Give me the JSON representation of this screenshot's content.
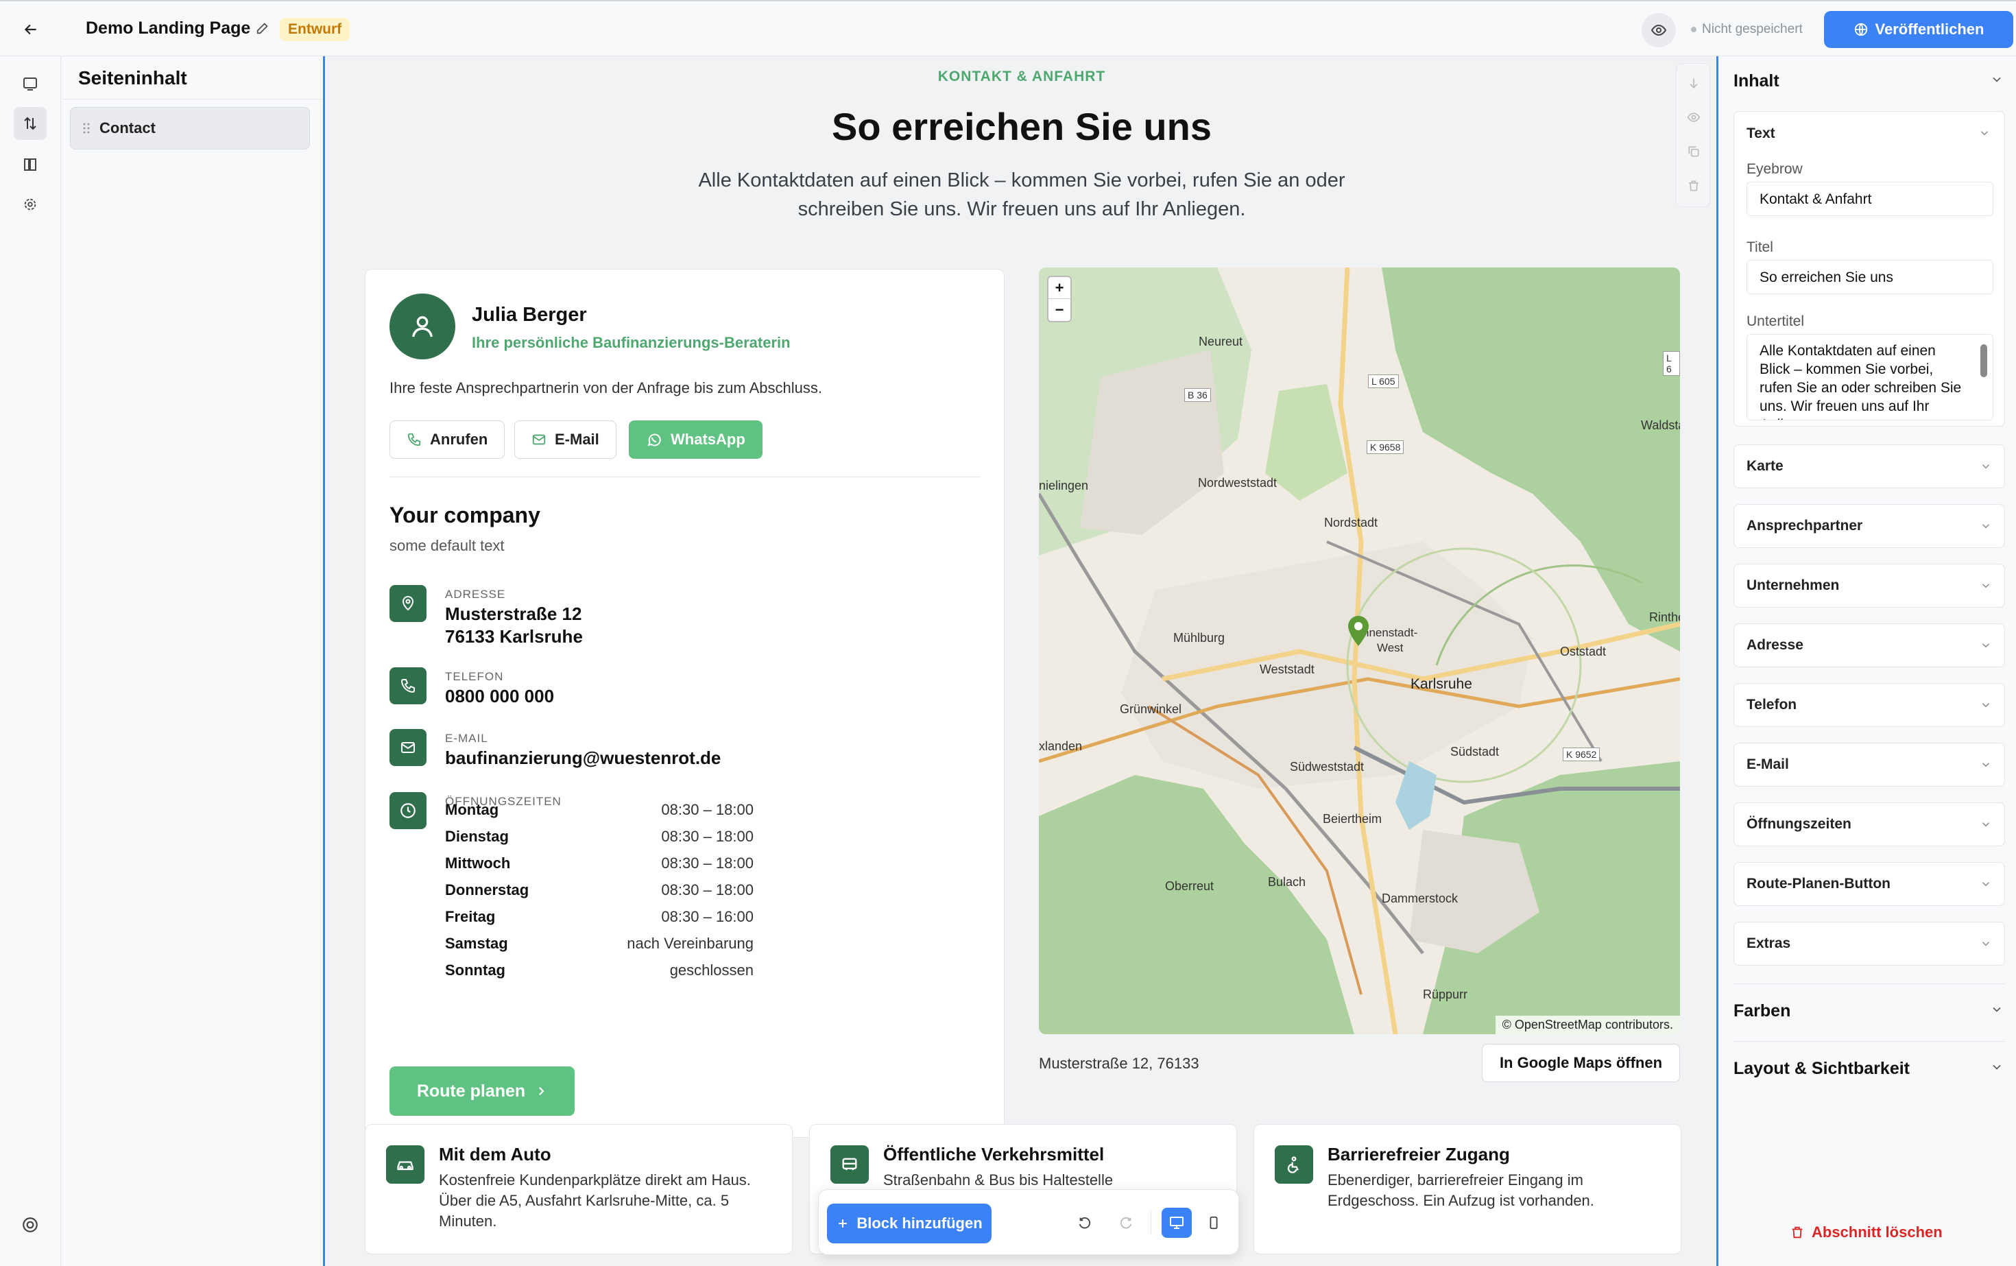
{
  "app": {
    "page_title": "Demo Landing Page",
    "status_badge": "Entwurf",
    "save_status": "Nicht gespeichert",
    "publish_label": "Veröffentlichen"
  },
  "left_panel": {
    "title": "Seiteninhalt",
    "items": [
      {
        "label": "Contact"
      }
    ]
  },
  "section": {
    "eyebrow": "KONTAKT & ANFAHRT",
    "title": "So erreichen Sie uns",
    "subtitle": "Alle Kontaktdaten auf einen Blick – kommen Sie vorbei, rufen Sie an oder schreiben Sie uns. Wir freuen uns auf Ihr Anliegen."
  },
  "contact_person": {
    "name": "Julia Berger",
    "role": "Ihre persönliche Baufinanzierungs-Beraterin",
    "description": "Ihre feste Ansprechpartnerin von der Anfrage bis zum Abschluss.",
    "buttons": {
      "call": "Anrufen",
      "email": "E-Mail",
      "whatsapp": "WhatsApp"
    }
  },
  "company": {
    "name": "Your company",
    "subtitle": "some default text",
    "address_label": "ADRESSE",
    "address_line1": "Musterstraße 12",
    "address_line2": "76133 Karlsruhe",
    "phone_label": "TELEFON",
    "phone": "0800 000 000",
    "email_label": "E-MAIL",
    "email": "baufinanzierung@wuestenrot.de",
    "hours_label": "ÖFFNUNGSZEITEN",
    "hours": [
      {
        "day": "Montag",
        "time": "08:30 – 18:00"
      },
      {
        "day": "Dienstag",
        "time": "08:30 – 18:00"
      },
      {
        "day": "Mittwoch",
        "time": "08:30 – 18:00"
      },
      {
        "day": "Donnerstag",
        "time": "08:30 – 18:00"
      },
      {
        "day": "Freitag",
        "time": "08:30 – 16:00"
      },
      {
        "day": "Samstag",
        "time": "nach Vereinbarung"
      },
      {
        "day": "Sonntag",
        "time": "geschlossen"
      }
    ],
    "route_button": "Route planen"
  },
  "map": {
    "attribution": "© OpenStreetMap contributors.",
    "zoom_in": "+",
    "zoom_out": "−",
    "places": {
      "neureut": "Neureut",
      "nordweststadt": "Nordweststadt",
      "nordstadt": "Nordstadt",
      "muehlburg": "Mühlburg",
      "weststadt": "Weststadt",
      "innenstadt": "nnenstadt-\nWest",
      "karlsruhe": "Karlsruhe",
      "oststadt": "Oststadt",
      "grunwinkel": "Grünwinkel",
      "suedweststadt": "Südweststadt",
      "suedstadt": "Südstadt",
      "beiertheim": "Beiertheim",
      "oberreut": "Oberreut",
      "bulach": "Bulach",
      "dammerstock": "Dammerstock",
      "rueppurr": "Rüppurr",
      "rintheim": "Rinthe",
      "waldstadt": "Waldsta",
      "knielingen": "nielingen",
      "daxlanden": "xlanden",
      "l605": "L 605",
      "k9658": "K 9658",
      "b36": "B 36",
      "k9652": "K 9652",
      "l6": "L 6"
    },
    "address": "Musterstraße 12, 76133",
    "google_button": "In Google Maps öffnen"
  },
  "features": [
    {
      "icon": "car-icon",
      "title": "Mit dem Auto",
      "text": "Kostenfreie Kundenparkplätze direkt am Haus. Über die A5, Ausfahrt Karlsruhe-Mitte, ca. 5 Minuten."
    },
    {
      "icon": "bus-icon",
      "title": "Öffentliche Verkehrsmittel",
      "text": "Straßenbahn & Bus bis Haltestelle"
    },
    {
      "icon": "accessibility-icon",
      "title": "Barrierefreier Zugang",
      "text": "Ebenerdiger, barrierefreier Eingang im Erdgeschoss. Ein Aufzug ist vorhanden."
    }
  ],
  "toolbar": {
    "add_block": "Block hinzufügen"
  },
  "right_panel": {
    "content_header": "Inhalt",
    "text_section": "Text",
    "eyebrow_label": "Eyebrow",
    "eyebrow_value": "Kontakt & Anfahrt",
    "title_label": "Titel",
    "title_value": "So erreichen Sie uns",
    "subtitle_label": "Untertitel",
    "subtitle_value": "Alle Kontaktdaten auf einen Blick – kommen Sie vorbei, rufen Sie an oder schreiben Sie uns. Wir freuen uns auf Ihr Anliegen.",
    "sections": [
      "Karte",
      "Ansprechpartner",
      "Unternehmen",
      "Adresse",
      "Telefon",
      "E-Mail",
      "Öffnungszeiten",
      "Route-Planen-Button",
      "Extras"
    ],
    "colors_header": "Farben",
    "layout_header": "Layout & Sichtbarkeit",
    "delete_section": "Abschnitt löschen"
  },
  "colors": {
    "accent": "#3b82f6",
    "brand_green": "#2f6f4b",
    "button_green": "#5fc282",
    "eyebrow_green": "#4fa770",
    "draft_badge": "#fef3c7",
    "delete_red": "#dc2626"
  }
}
